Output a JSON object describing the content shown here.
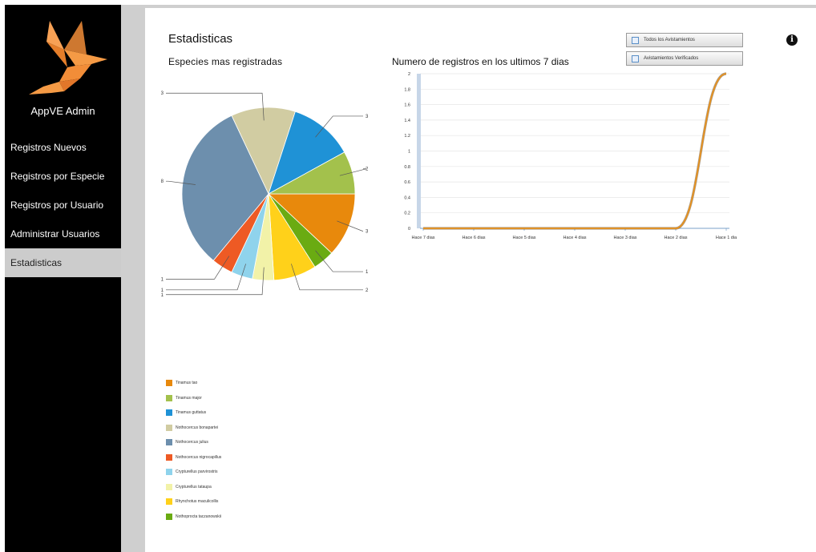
{
  "sidebar": {
    "app_title": "AppVE Admin",
    "items": [
      {
        "label": "Registros Nuevos",
        "active": false
      },
      {
        "label": "Registros por Especie",
        "active": false
      },
      {
        "label": "Registros por Usuario",
        "active": false
      },
      {
        "label": "Administrar Usuarios",
        "active": false
      },
      {
        "label": "Estadisticas",
        "active": true
      }
    ]
  },
  "main": {
    "title": "Estadisticas",
    "buttons": {
      "all_sightings": "Todos los Avistamientos",
      "verified_sightings": "Avistamientos Verificados"
    },
    "info_icon": "info-icon"
  },
  "colors": {
    "logo": "#f28d38",
    "sidebar": "#000000",
    "active_nav": "#cccccc",
    "line_series": "#e8911c"
  },
  "chart_data": [
    {
      "type": "pie",
      "title": "Especies mas registradas",
      "slices": [
        {
          "name": "Tinamus tao",
          "value": 3,
          "color": "#e8890c"
        },
        {
          "name": "Tinamus major",
          "value": 1,
          "color": "#6aab12"
        },
        {
          "name": "Tinamus guttatus",
          "value": 2,
          "color": "#ffd11a"
        },
        {
          "name": "Nothocercus bonapartei",
          "value": 1,
          "color": "#f2f2a8"
        },
        {
          "name": "Nothocercus julius",
          "value": 1,
          "color": "#8fd3ec"
        },
        {
          "name": "Nothocercus nigrocapillus",
          "value": 1,
          "color": "#ee5a24"
        },
        {
          "name": "Crypturellus parvirostris",
          "value": 8,
          "color": "#6d8fad"
        },
        {
          "name": "Crypturellus tataupa",
          "value": 3,
          "color": "#d1cca2"
        },
        {
          "name": "Rhynchotus maculicollis",
          "value": 3,
          "color": "#1f92d6"
        },
        {
          "name": "Nothoprocta taczanowskii",
          "value": 2,
          "color": "#a3c14c"
        }
      ],
      "legend": [
        {
          "name": "Tinamus tao",
          "color": "#e8890c"
        },
        {
          "name": "Tinamus major",
          "color": "#a3c14c"
        },
        {
          "name": "Tinamus guttatus",
          "color": "#1f92d6"
        },
        {
          "name": "Nothocercus bonapartei",
          "color": "#d1cca2"
        },
        {
          "name": "Nothocercus julius",
          "color": "#6d8fad"
        },
        {
          "name": "Nothocercus nigrocapillus",
          "color": "#ee5a24"
        },
        {
          "name": "Crypturellus parvirostris",
          "color": "#8fd3ec"
        },
        {
          "name": "Crypturellus tataupa",
          "color": "#f2f2a8"
        },
        {
          "name": "Rhynchotus maculicollis",
          "color": "#ffd11a"
        },
        {
          "name": "Nothoprocta taczanowskii",
          "color": "#6aab12"
        }
      ]
    },
    {
      "type": "line",
      "title": "Numero de registros en los ultimos 7 dias",
      "categories": [
        "Hace 7 dias",
        "Hace 6 dias",
        "Hace 5 dias",
        "Hace 4 dias",
        "Hace 3 dias",
        "Hace 2 dias",
        "Hace 1 dia"
      ],
      "series": [
        {
          "values": [
            0,
            0,
            0,
            0,
            0,
            0,
            2
          ]
        }
      ],
      "y_ticks": [
        "0",
        "0.2",
        "0.4",
        "0.6",
        "0.8",
        "1",
        "1.2",
        "1.4",
        "1.6",
        "1.8",
        "2"
      ],
      "ylim": [
        0,
        2
      ],
      "grid": true
    }
  ]
}
